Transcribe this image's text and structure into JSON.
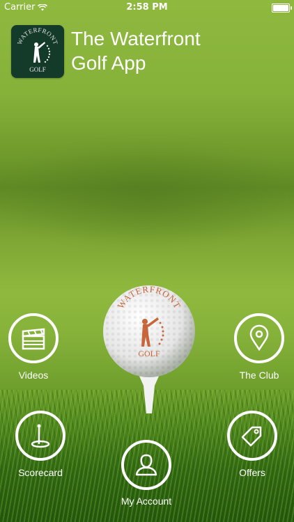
{
  "status_bar": {
    "carrier": "Carrier",
    "time": "2:58 PM"
  },
  "header": {
    "title_line1": "The Waterfront",
    "title_line2": "Golf App"
  },
  "logo": {
    "text_top": "WATERFRONT",
    "text_bottom": "GOLF"
  },
  "nav": {
    "videos": "Videos",
    "the_club": "The Club",
    "scorecard": "Scorecard",
    "offers": "Offers",
    "my_account": "My Account"
  },
  "icons": {
    "videos": "clapperboard-icon",
    "the_club": "map-pin-icon",
    "scorecard": "golf-flag-icon",
    "offers": "tag-icon",
    "my_account": "user-icon"
  },
  "colors": {
    "logo_bg": "#143a2a",
    "logo_accent": "#c8653a",
    "ring": "#ffffff"
  }
}
